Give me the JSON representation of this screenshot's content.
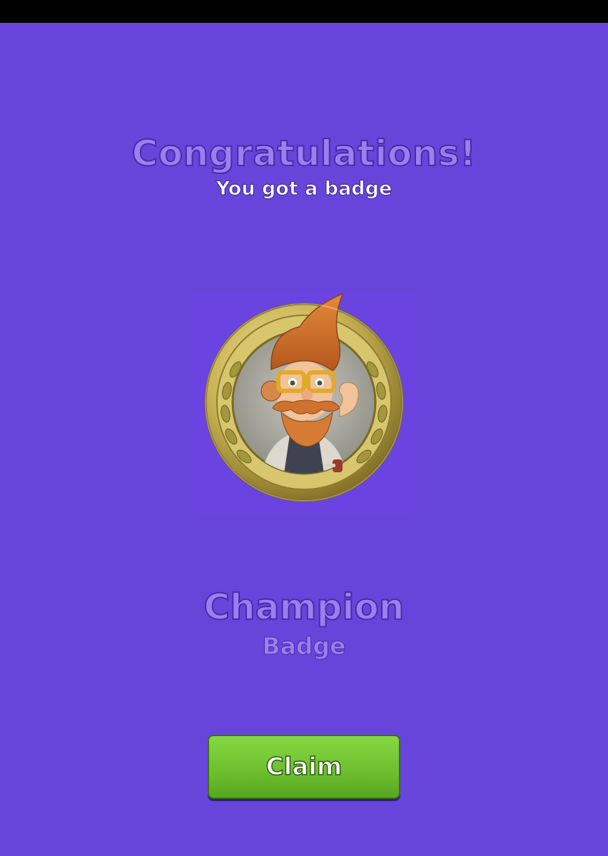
{
  "header": {
    "title": "Congratulations!",
    "subtitle": "You got a badge"
  },
  "badge": {
    "name": "Champion",
    "type": "Badge",
    "icon": "champion-badge-medal"
  },
  "actions": {
    "claim_label": "Claim"
  },
  "colors": {
    "background": "#6845da",
    "title_fill": "#9b7ff0",
    "button_green": "#6cbe2e"
  }
}
